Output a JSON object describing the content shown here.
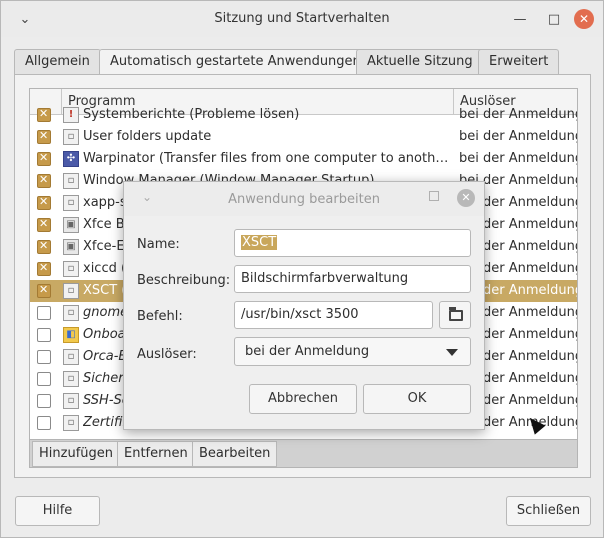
{
  "window": {
    "title": "Sitzung und Startverhalten"
  },
  "tabs": [
    {
      "label": "Allgemein",
      "active": false
    },
    {
      "label": "Automatisch gestartete Anwendungen",
      "active": true
    },
    {
      "label": "Aktuelle Sitzung",
      "active": false
    },
    {
      "label": "Erweitert",
      "active": false
    }
  ],
  "list": {
    "columns": {
      "program": "Programm",
      "trigger": "Auslöser"
    },
    "rows": [
      {
        "checked": true,
        "icon": "alert-icon",
        "name": "Systemberichte (Probleme lösen)",
        "trigger": "bei der Anmeldung",
        "italic": false
      },
      {
        "checked": true,
        "icon": "generic-app-icon",
        "name": "User folders update",
        "trigger": "bei der Anmeldung",
        "italic": false
      },
      {
        "checked": true,
        "icon": "warpinator-icon",
        "name": "Warpinator (Transfer files from one computer to another over LAN)",
        "trigger": "bei der Anmeldung",
        "italic": false
      },
      {
        "checked": true,
        "icon": "generic-app-icon",
        "name": "Window Manager (Window Manager Startup)",
        "trigger": "bei der Anmeldung",
        "italic": false
      },
      {
        "checked": true,
        "icon": "generic-app-icon",
        "name": "xapp-sn-watcher",
        "trigger": "bei der Anmeldung",
        "italic": false
      },
      {
        "checked": true,
        "icon": "xfce-icon",
        "name": "Xfce Bereitstellung",
        "trigger": "bei der Anmeldung",
        "italic": false
      },
      {
        "checked": true,
        "icon": "xfce-icon",
        "name": "Xfce-Einstellungsdienst",
        "trigger": "bei der Anmeldung",
        "italic": false
      },
      {
        "checked": true,
        "icon": "generic-app-icon",
        "name": "xiccd (Automatisches Farbmanagement)",
        "trigger": "bei der Anmeldung",
        "italic": false
      },
      {
        "checked": true,
        "icon": "generic-app-icon",
        "name": "XSCT (Bildschirmfarbverwaltung)",
        "trigger": "bei der Anmeldung",
        "italic": false,
        "selected": true
      },
      {
        "checked": false,
        "icon": "generic-app-icon",
        "name": "gnome-keyring: GPG Agent",
        "trigger": "bei der Anmeldung",
        "italic": true
      },
      {
        "checked": false,
        "icon": "onboard-icon",
        "name": "Onboard",
        "trigger": "bei der Anmeldung",
        "italic": true
      },
      {
        "checked": false,
        "icon": "generic-app-icon",
        "name": "Orca-Bildschirmleser",
        "trigger": "bei der Anmeldung",
        "italic": true
      },
      {
        "checked": false,
        "icon": "generic-app-icon",
        "name": "Sicherheitsdienst des Schlüsselbunds",
        "trigger": "bei der Anmeldung",
        "italic": true
      },
      {
        "checked": false,
        "icon": "generic-app-icon",
        "name": "SSH-Schlüsselagent",
        "trigger": "bei der Anmeldung",
        "italic": true
      },
      {
        "checked": false,
        "icon": "generic-app-icon",
        "name": "Zertifikats- und Schlüsselspeicher",
        "trigger": "bei der Anmeldung",
        "italic": true
      }
    ]
  },
  "toolbar": {
    "add": "Hinzufügen",
    "remove": "Entfernen",
    "edit": "Bearbeiten"
  },
  "footer": {
    "help": "Hilfe",
    "close": "Schließen"
  },
  "dialog": {
    "title": "Anwendung bearbeiten",
    "name_label": "Name:",
    "name_value": "XSCT",
    "description_label": "Beschreibung:",
    "description_value": "Bildschirmfarbverwaltung",
    "command_label": "Befehl:",
    "command_value": "/usr/bin/xsct 3500",
    "trigger_label": "Auslöser:",
    "trigger_value": "bei der Anmeldung",
    "cancel": "Abbrechen",
    "ok": "OK"
  },
  "colors": {
    "accent": "#c8a964",
    "close_button": "#e26d4f"
  }
}
